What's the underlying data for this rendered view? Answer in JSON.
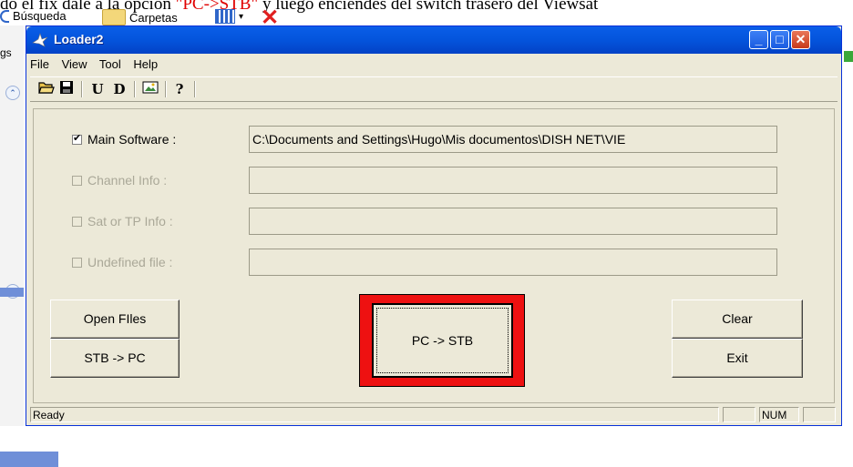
{
  "background": {
    "top_text_pre": "do el fix dale a la opción ",
    "top_text_red": "\"PC->STB\"",
    "top_text_post": " y luego enciendes del switch trasero del Viewsat",
    "explorer_search": "Búsqueda",
    "explorer_folders": "Carpetas",
    "side_label": "gs"
  },
  "window": {
    "title": "Loader2",
    "menu": [
      "File",
      "View",
      "Tool",
      "Help"
    ],
    "toolbar": {
      "open_icon": "open-folder-icon",
      "save_icon": "save-disk-icon",
      "u_label": "U",
      "d_label": "D",
      "image_icon": "image-icon",
      "help_label": "?"
    },
    "files": [
      {
        "label": "Main Software :",
        "checked": true,
        "enabled": true,
        "value": "C:\\Documents and Settings\\Hugo\\Mis documentos\\DISH NET\\VIE"
      },
      {
        "label": "Channel Info :",
        "checked": false,
        "enabled": false,
        "value": ""
      },
      {
        "label": "Sat or TP Info :",
        "checked": false,
        "enabled": false,
        "value": ""
      },
      {
        "label": "Undefined file :",
        "checked": false,
        "enabled": false,
        "value": ""
      }
    ],
    "buttons": {
      "open_files": "Open FIles",
      "stb_to_pc": "STB -> PC",
      "pc_to_stb": "PC -> STB",
      "clear": "Clear",
      "exit": "Exit"
    },
    "status": {
      "message": "Ready",
      "num": "NUM"
    }
  },
  "colors": {
    "title_bar": "#0454dc",
    "window_bg": "#ece9d8",
    "highlight_frame": "#ee1111"
  }
}
